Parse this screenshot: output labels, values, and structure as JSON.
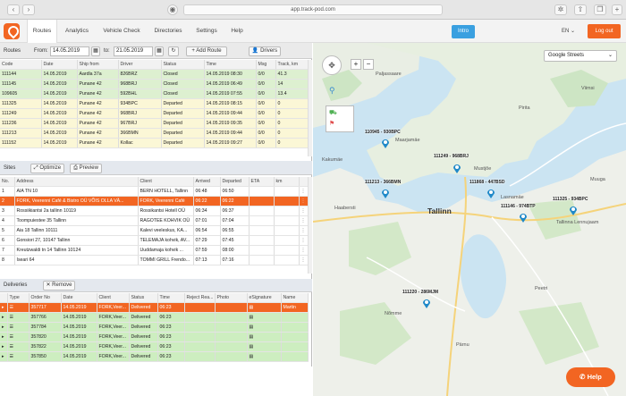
{
  "browser": {
    "url": "app.track-pod.com"
  },
  "nav": {
    "items": [
      "Routes",
      "Analytics",
      "Vehicle Check",
      "Directories",
      "Settings",
      "Help"
    ],
    "intro": "Intro",
    "lang": "EN",
    "logout": "Log out"
  },
  "routes": {
    "label": "Routes",
    "from_label": "From:",
    "from": "14.05.2019",
    "to_label": "to:",
    "to": "21.05.2019",
    "add_route": "+ Add Route",
    "drivers": "Drivers",
    "columns": [
      "Code",
      "Date",
      "Ship from",
      "Driver",
      "Status",
      "Time",
      "Msg",
      "Track, km"
    ],
    "rows": [
      {
        "code": "111144",
        "date": "14.05.2019",
        "ship": "Aardla 37a",
        "driver": "826BRZ",
        "status": "Closed",
        "time": "14.05.2019 08:30",
        "msg": "0/0",
        "km": "41.3"
      },
      {
        "code": "111145",
        "date": "14.05.2019",
        "ship": "Punane 42",
        "driver": "968BRJ",
        "status": "Closed",
        "time": "14.05.2019 06:49",
        "msg": "0/0",
        "km": "14"
      },
      {
        "code": "109605",
        "date": "14.05.2019",
        "ship": "Punane 42",
        "driver": "592BHL",
        "status": "Closed",
        "time": "14.05.2019 07:55",
        "msg": "0/0",
        "km": "13.4"
      },
      {
        "code": "111325",
        "date": "14.05.2019",
        "ship": "Punane 42",
        "driver": "934BPC",
        "status": "Departed",
        "time": "14.05.2019 08:15",
        "msg": "0/0",
        "km": "0"
      },
      {
        "code": "111249",
        "date": "14.05.2019",
        "ship": "Punane 42",
        "driver": "968BRJ",
        "status": "Departed",
        "time": "14.05.2019 09:44",
        "msg": "0/0",
        "km": "0"
      },
      {
        "code": "111236",
        "date": "14.05.2019",
        "ship": "Punane 42",
        "driver": "967BRJ",
        "status": "Departed",
        "time": "14.05.2019 09:35",
        "msg": "0/0",
        "km": "0"
      },
      {
        "code": "111213",
        "date": "14.05.2019",
        "ship": "Punane 42",
        "driver": "366BMN",
        "status": "Departed",
        "time": "14.05.2019 09:44",
        "msg": "0/0",
        "km": "0"
      },
      {
        "code": "111152",
        "date": "14.05.2019",
        "ship": "Punane 42",
        "driver": "Kollac",
        "status": "Departed",
        "time": "14.05.2019 09:27",
        "msg": "0/0",
        "km": "0"
      }
    ]
  },
  "sites": {
    "label": "Sites",
    "optimize": "Optimize",
    "preview": "Preview",
    "columns": [
      "No.",
      "Address",
      "Client",
      "Arrived",
      "Departed",
      "ETA",
      "km"
    ],
    "rows": [
      {
        "no": "1",
        "addr": "AIA TN 10",
        "client": "BERN HOTELL, Tallinn",
        "arr": "06:48",
        "dep": "06:50"
      },
      {
        "no": "2",
        "addr": "FORK, Veerenni Café & Bistro OÜ VÕIS OLLA VÄ...",
        "client": "FORK, Veerenni Café",
        "arr": "06:22",
        "dep": "06:22"
      },
      {
        "no": "3",
        "addr": "Rossiikiantsi 2a tallinn 10119",
        "client": "Rossikantsi Hotell OÜ",
        "arr": "06:34",
        "dep": "06:37"
      },
      {
        "no": "4",
        "addr": "Toompuiestee 35 Tallinn",
        "client": "RAGOTEE KOHVIK OÜ",
        "arr": "07:01",
        "dep": "07:04"
      },
      {
        "no": "5",
        "addr": "Aia 18 Tallinn 10111",
        "client": "Kalevi veeleskus, KA...",
        "arr": "06:54",
        "dep": "06:55"
      },
      {
        "no": "6",
        "addr": "Gonsiori 27, 10147 Tallinn",
        "client": "TELEMAJA kohvik, AV...",
        "arr": "07:29",
        "dep": "07:45"
      },
      {
        "no": "7",
        "addr": "Kreutzwaldi tn 14 Tallinn 10124",
        "client": "Uuddamaja kohvik ...",
        "arr": "07:59",
        "dep": "08:00"
      },
      {
        "no": "8",
        "addr": "Iseari 64",
        "client": "TOMMI GRILL Frendo...",
        "arr": "07:13",
        "dep": "07:16"
      }
    ]
  },
  "deliveries": {
    "label": "Deliveries",
    "remove": "Remove",
    "columns": [
      "Type",
      "Order No",
      "Date",
      "Client",
      "Status",
      "Time",
      "Reject Rea...",
      "Photo",
      "eSignature",
      "Name"
    ],
    "rows": [
      {
        "order": "357717",
        "date": "14.05.2019",
        "client": "FORK,Veer...",
        "status": "Delivered",
        "time": "06:23",
        "name": "Martin"
      },
      {
        "order": "357766",
        "date": "14.05.2019",
        "client": "FORK,Veer...",
        "status": "Delivered",
        "time": "06:23",
        "name": ""
      },
      {
        "order": "357784",
        "date": "14.05.2019",
        "client": "FORK,Veer...",
        "status": "Delivered",
        "time": "06:23",
        "name": ""
      },
      {
        "order": "357820",
        "date": "14.05.2019",
        "client": "FORK,Veer...",
        "status": "Delivered",
        "time": "06:23",
        "name": ""
      },
      {
        "order": "357822",
        "date": "14.05.2019",
        "client": "FORK,Veer...",
        "status": "Delivered",
        "time": "06:23",
        "name": ""
      },
      {
        "order": "357850",
        "date": "14.05.2019",
        "client": "FORK,Veer...",
        "status": "Delivered",
        "time": "06:23",
        "name": ""
      }
    ]
  },
  "map": {
    "type": "Google Streets",
    "city": "Tallinn",
    "pins": [
      {
        "label": "110945 - 930BPC"
      },
      {
        "label": "111249 - 968BRJ"
      },
      {
        "label": "111213 - 366BMN"
      },
      {
        "label": "111868 - 447BSD"
      },
      {
        "label": "111325 - 934BPC"
      },
      {
        "label": "111146 - 974BTP"
      },
      {
        "label": "111220 - 286MJM"
      }
    ],
    "places": [
      "Paljassaare",
      "Maarjamäe",
      "Lasnamäe",
      "Nõmme",
      "Pirita",
      "Viimsi",
      "Peetri",
      "Muuga",
      "Mustjõe",
      "Tallinna Lennujaam",
      "Haabersti",
      "Kakumäe",
      "Pärnu"
    ],
    "help": "Help"
  },
  "colors": {
    "accent": "#f26522",
    "intro": "#3aa0e0",
    "pin": "#1e88c8"
  }
}
